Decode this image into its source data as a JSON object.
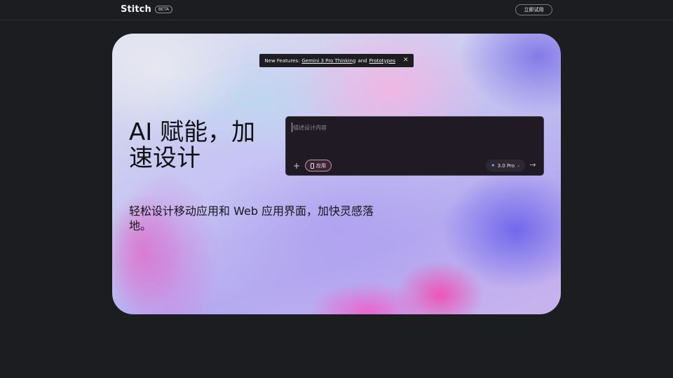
{
  "header": {
    "brand": "Stitch",
    "badge": "BETA",
    "cta_label": "立即试用"
  },
  "banner": {
    "prefix": "New Features:",
    "link1": "Gemini 3 Pro Thinking",
    "joiner": "and",
    "link2": "Prototypes",
    "close_glyph": "✕"
  },
  "hero": {
    "title": "AI 赋能，加速设计",
    "subtitle": "轻松设计移动应用和 Web 应用界面，加快灵感落地。"
  },
  "prompt": {
    "placeholder": "描述设计内容",
    "plus_glyph": "+",
    "app_chip_label": "应用",
    "model_label": "3.0 Pro",
    "model_icon_glyph": "✦",
    "chevron_glyph": "⌄",
    "send_glyph": "→"
  },
  "icons": {
    "plus": "plus-icon",
    "app": "phone-icon",
    "model": "gemini-spark-icon",
    "chevron": "chevron-down-icon",
    "send": "arrow-right-icon",
    "close": "close-icon"
  },
  "colors": {
    "page_bg": "#1c1d20",
    "prompt_bg": "#201a25",
    "chip_border": "#c98db0"
  }
}
